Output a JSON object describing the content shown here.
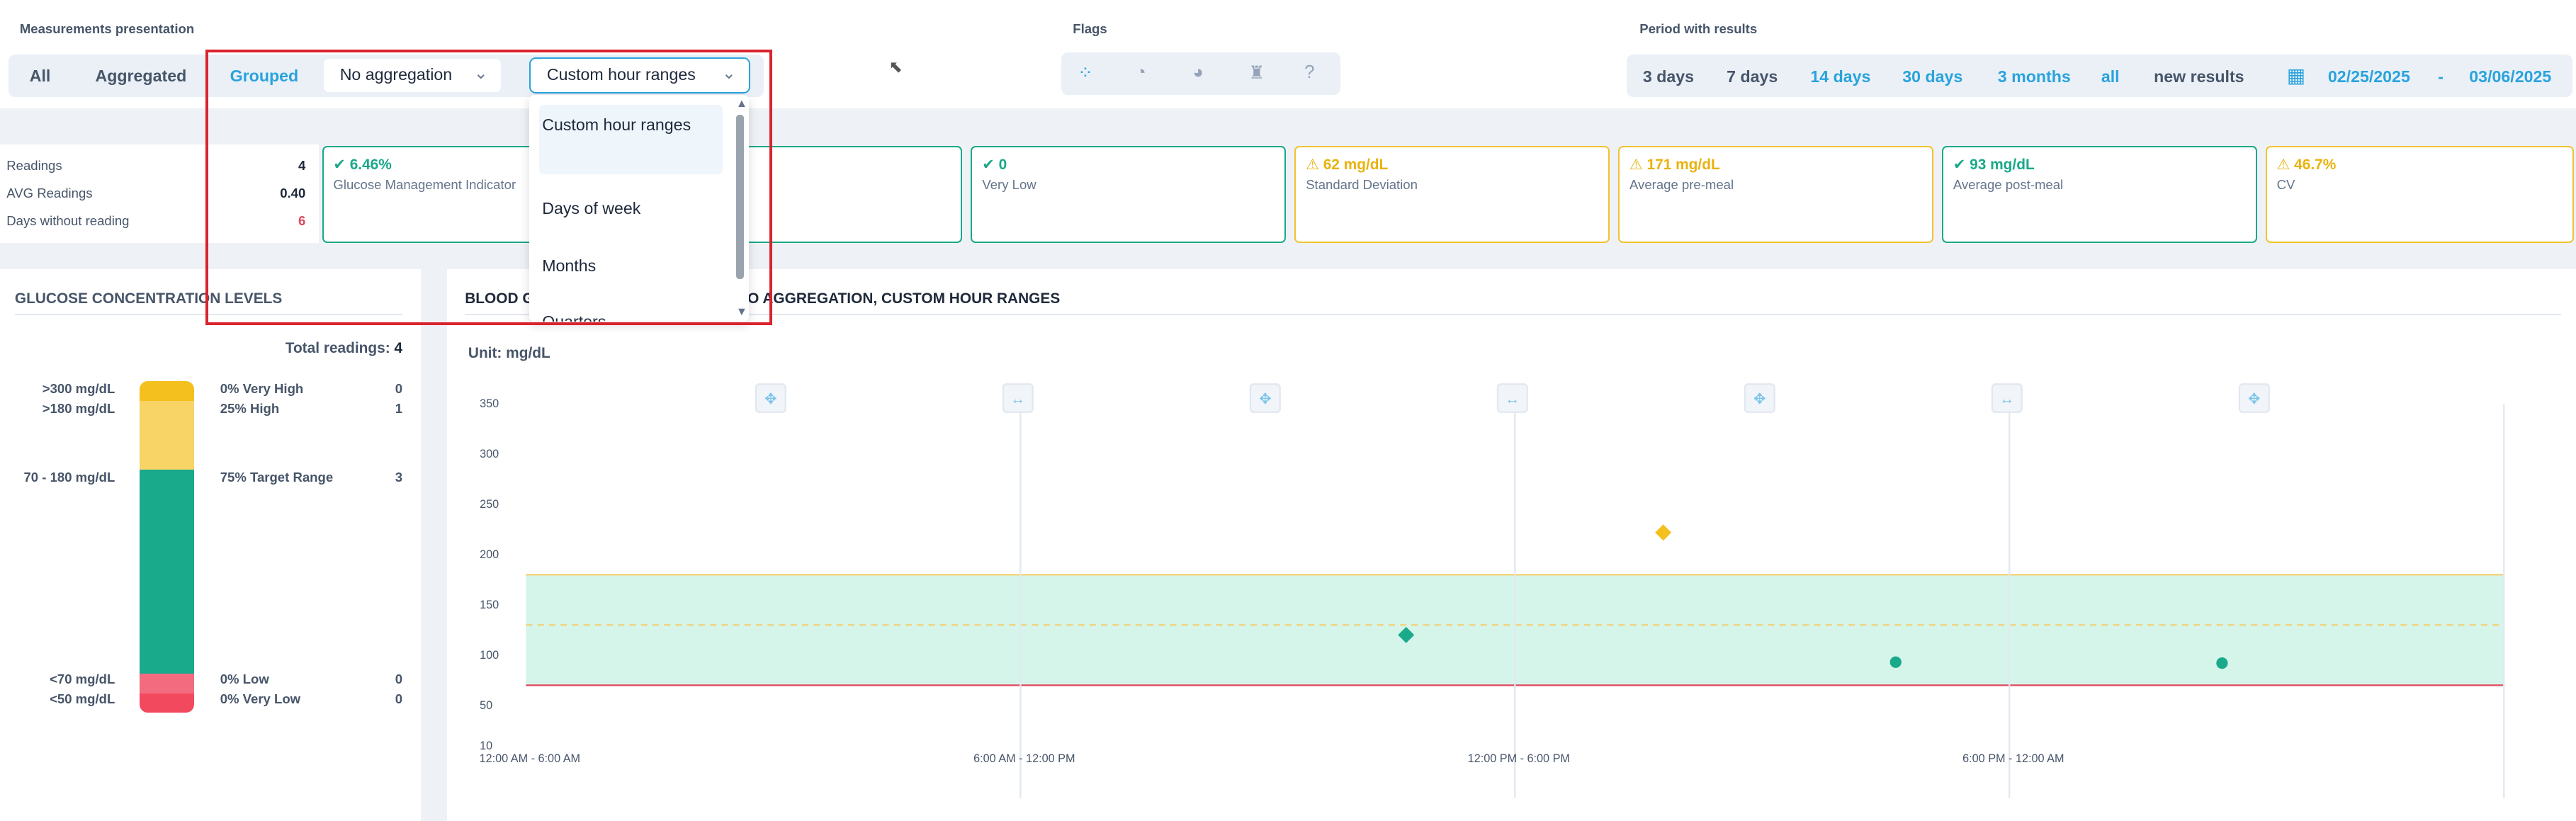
{
  "header": {
    "presentation_label": "Measurements presentation",
    "flags_label": "Flags",
    "period_label": "Period with results"
  },
  "presentation": {
    "tabs": [
      "All",
      "Aggregated",
      "Grouped"
    ],
    "active_tab": "Grouped",
    "aggregation_select": "No aggregation",
    "grouping_select": "Custom hour ranges"
  },
  "dropdown": {
    "options": [
      "Custom hour ranges",
      "Days of week",
      "Months",
      "Quarters"
    ],
    "selected": "Custom hour ranges"
  },
  "flags": {
    "icons": [
      "all-flags-icon",
      "before-meal-icon",
      "after-meal-icon",
      "exercise-icon",
      "help-icon"
    ]
  },
  "period": {
    "options": [
      "3 days",
      "7 days",
      "14 days",
      "30 days",
      "3 months",
      "all",
      "new results"
    ],
    "start_date": "02/25/2025",
    "separator": "-",
    "end_date": "03/06/2025"
  },
  "summary": {
    "rows": [
      {
        "label": "Readings",
        "value": "4"
      },
      {
        "label": "AVG Readings",
        "value": "0.40"
      },
      {
        "label": "Days without reading",
        "value": "6"
      }
    ]
  },
  "cards": [
    {
      "value": "6.46%",
      "label": "Glucose Management Indicator",
      "status": "ok"
    },
    {
      "value": "0",
      "label": "Very Low",
      "status": "ok"
    },
    {
      "value": "62 mg/dL",
      "label": "Standard Deviation",
      "status": "warn"
    },
    {
      "value": "171 mg/dL",
      "label": "Average pre-meal",
      "status": "warn"
    },
    {
      "value": "93 mg/dL",
      "label": "Average post-meal",
      "status": "ok"
    },
    {
      "value": "46.7%",
      "label": "CV",
      "status": "warn"
    }
  ],
  "glucose_levels": {
    "title": "GLUCOSE CONCENTRATION LEVELS",
    "total_label": "Total readings:",
    "total_value": "4",
    "levels": [
      {
        "range": ">300 mg/dL",
        "percent": "0% Very High",
        "count": "0",
        "color": "#f4c01e",
        "fraction": 0.0
      },
      {
        "range": ">180 mg/dL",
        "percent": "25% High",
        "count": "1",
        "color": "#f7d465",
        "fraction": 0.25
      },
      {
        "range": "70 - 180 mg/dL",
        "percent": "75% Target Range",
        "count": "3",
        "color": "#19a98b",
        "fraction": 0.75
      },
      {
        "range": "<70 mg/dL",
        "percent": "0% Low",
        "count": "0",
        "color": "#f26b7f",
        "fraction": 0.0
      },
      {
        "range": "<50 mg/dL",
        "percent": "0% Very Low",
        "count": "0",
        "color": "#f2495f",
        "fraction": 0.0
      }
    ]
  },
  "chart_panel": {
    "title_prefix": "BLOOD G",
    "title_suffix": "O AGGREGATION, CUSTOM HOUR RANGES",
    "unit": "Unit: mg/dL"
  },
  "chart_data": {
    "type": "scatter",
    "categories": [
      "12:00 AM - 6:00 AM",
      "6:00 AM - 12:00 PM",
      "12:00 PM - 6:00 PM",
      "6:00 PM - 12:00 AM"
    ],
    "y_ticks": [
      350,
      300,
      250,
      200,
      150,
      100,
      50,
      10
    ],
    "ylim": [
      10,
      350
    ],
    "target_range": [
      70,
      180
    ],
    "thresholds": {
      "high": 180,
      "pre_meal_target": 130,
      "low": 70
    },
    "points": [
      {
        "category": "6:00 AM - 12:00 PM",
        "offset": 0.78,
        "y": 120,
        "marker": "diamond",
        "color": "#19a98b"
      },
      {
        "category": "12:00 PM - 6:00 PM",
        "offset": 0.3,
        "y": 222,
        "marker": "diamond",
        "color": "#f4c01e"
      },
      {
        "category": "12:00 PM - 6:00 PM",
        "offset": 0.77,
        "y": 93,
        "marker": "circle",
        "color": "#19a98b"
      },
      {
        "category": "6:00 PM - 12:00 AM",
        "offset": 0.43,
        "y": 92,
        "marker": "circle",
        "color": "#19a98b"
      }
    ],
    "colors": {
      "target_fill": "#d6f5ea",
      "high_line": "#f1d27a",
      "low_line": "#e0475c"
    }
  }
}
